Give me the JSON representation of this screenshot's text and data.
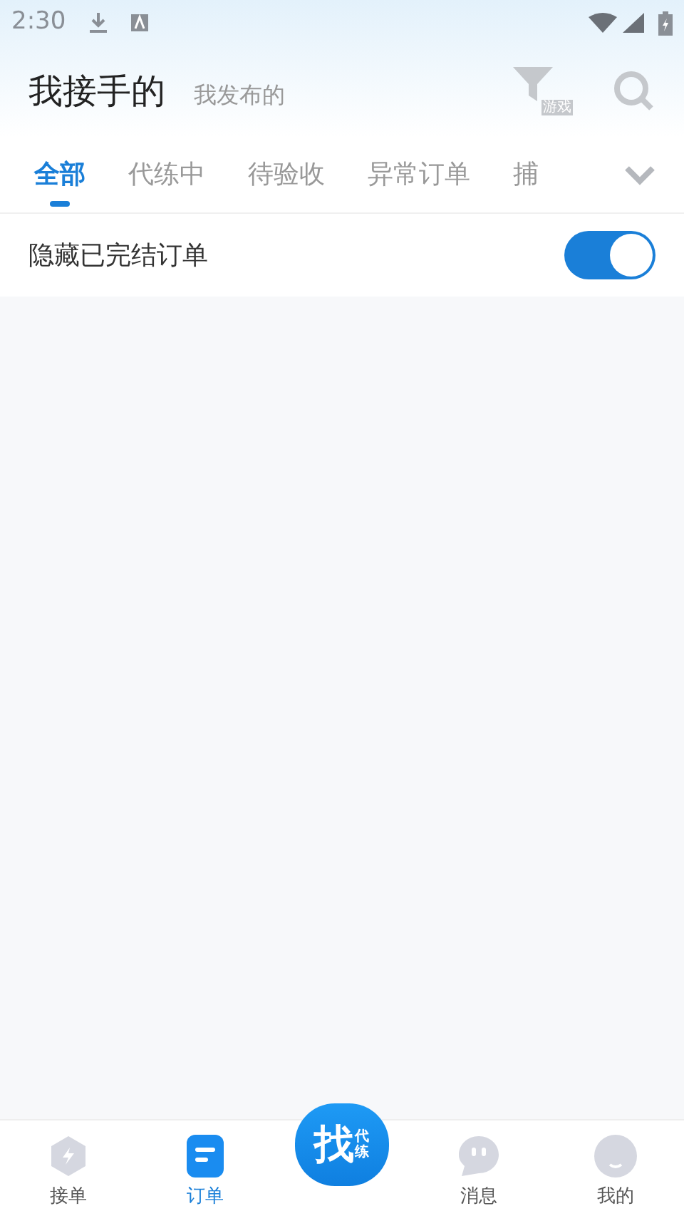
{
  "status_bar": {
    "time": "2:30"
  },
  "header_tabs": [
    {
      "label": "我接手的",
      "selected": true
    },
    {
      "label": "我发布的",
      "selected": false
    }
  ],
  "filter": {
    "badge": "游戏"
  },
  "tabs": [
    {
      "label": "全部",
      "selected": true
    },
    {
      "label": "代练中",
      "selected": false
    },
    {
      "label": "待验收",
      "selected": false
    },
    {
      "label": "异常订单",
      "selected": false
    },
    {
      "label": "捕",
      "selected": false
    }
  ],
  "hide_finished": {
    "label": "隐藏已完结订单",
    "on": true
  },
  "center_button": {
    "main": "找",
    "sub": "代练"
  },
  "bottom_nav": [
    {
      "kind": "bolt",
      "label": "接单",
      "selected": false
    },
    {
      "kind": "order",
      "label": "订单",
      "selected": true
    },
    {
      "kind": "center"
    },
    {
      "kind": "chat",
      "label": "消息",
      "selected": false
    },
    {
      "kind": "face",
      "label": "我的",
      "selected": false
    }
  ]
}
